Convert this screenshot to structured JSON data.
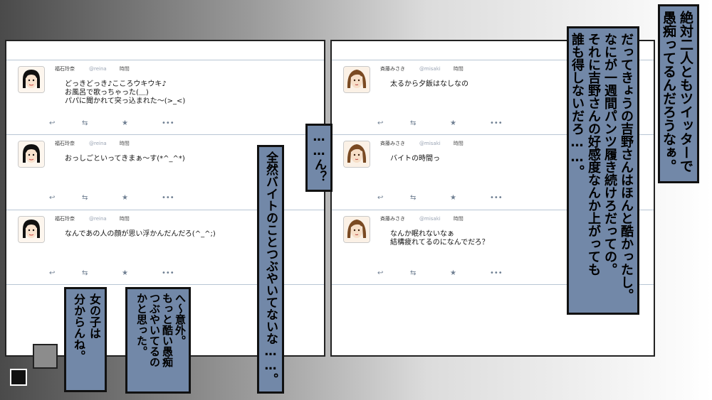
{
  "left_feed": {
    "tweets": [
      {
        "name": "福石玲奈",
        "handle": "@reina",
        "time": "時間",
        "text": "どっきどっき♪こころウキウキ♪\nお風呂で歌っちゃった(＿)\nパパに聞かれて突っ込まれた〜(>_<)"
      },
      {
        "name": "福石玲奈",
        "handle": "@reina",
        "time": "時間",
        "text": "おっしごといってきまぁ〜す(*^_^*)"
      },
      {
        "name": "福石玲奈",
        "handle": "@reina",
        "time": "時間",
        "text": "なんであの人の顔が思い浮かんだんだろ(^_^;)"
      }
    ]
  },
  "right_feed": {
    "tweets": [
      {
        "name": "斉藤みさき",
        "handle": "@misaki",
        "time": "時間",
        "text": "太るから夕飯はなしなの"
      },
      {
        "name": "斉藤みさき",
        "handle": "@misaki",
        "time": "時間",
        "text": "バイトの時間っ"
      },
      {
        "name": "斉藤みさき",
        "handle": "@misaki",
        "time": "時間",
        "text": "なんか眠れないなぁ\n結構疲れてるのになんでだろ？"
      }
    ]
  },
  "actions": {
    "reply": "↩",
    "retweet": "⇆",
    "favorite": "★",
    "more": "•••"
  },
  "bubbles": {
    "b1": "絶対二人ともツイッターで\n愚痴ってるんだろうなぁ。",
    "b2": "だってきょうの吉野さんはほんと酷かったし。\nなにが一週間パンツ履き続けろだっての。\nそれに吉野さんの好感度なんか上がっても\n誰も得しないだろ……。",
    "b3": "……ん？",
    "b4": "全然バイトのことつぶやいてないな……。",
    "b5": "へ〜意外。\nもっと酷い愚痴\nつぶやいてるの\nかと思った。",
    "b6": "女の子は\n分からんね。"
  },
  "colors": {
    "bubble": "#7288a8",
    "divider": "#b8c6d4",
    "icon": "#6f7f92"
  }
}
